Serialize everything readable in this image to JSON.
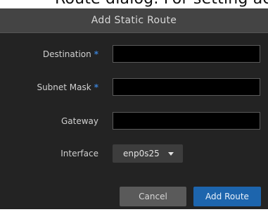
{
  "background_text": "Route dialog. For setting ae",
  "dialog": {
    "title": "Add Static Route",
    "fields": {
      "destination": {
        "label": "Destination",
        "value": "",
        "required": true
      },
      "subnet_mask": {
        "label": "Subnet Mask",
        "value": "",
        "required": true
      },
      "gateway": {
        "label": "Gateway",
        "value": "",
        "required": false
      },
      "interface": {
        "label": "Interface",
        "selected": "enp0s25"
      }
    },
    "required_marker": "*",
    "buttons": {
      "cancel": "Cancel",
      "submit": "Add Route"
    }
  },
  "colors": {
    "dialog_bg": "#232323",
    "header_bg": "#444444",
    "required_marker": "#3a7fd0",
    "primary_button": "#1d65ad",
    "secondary_button": "#5a5a5a"
  },
  "icons": {
    "interface_dropdown": "caret-down-icon"
  }
}
